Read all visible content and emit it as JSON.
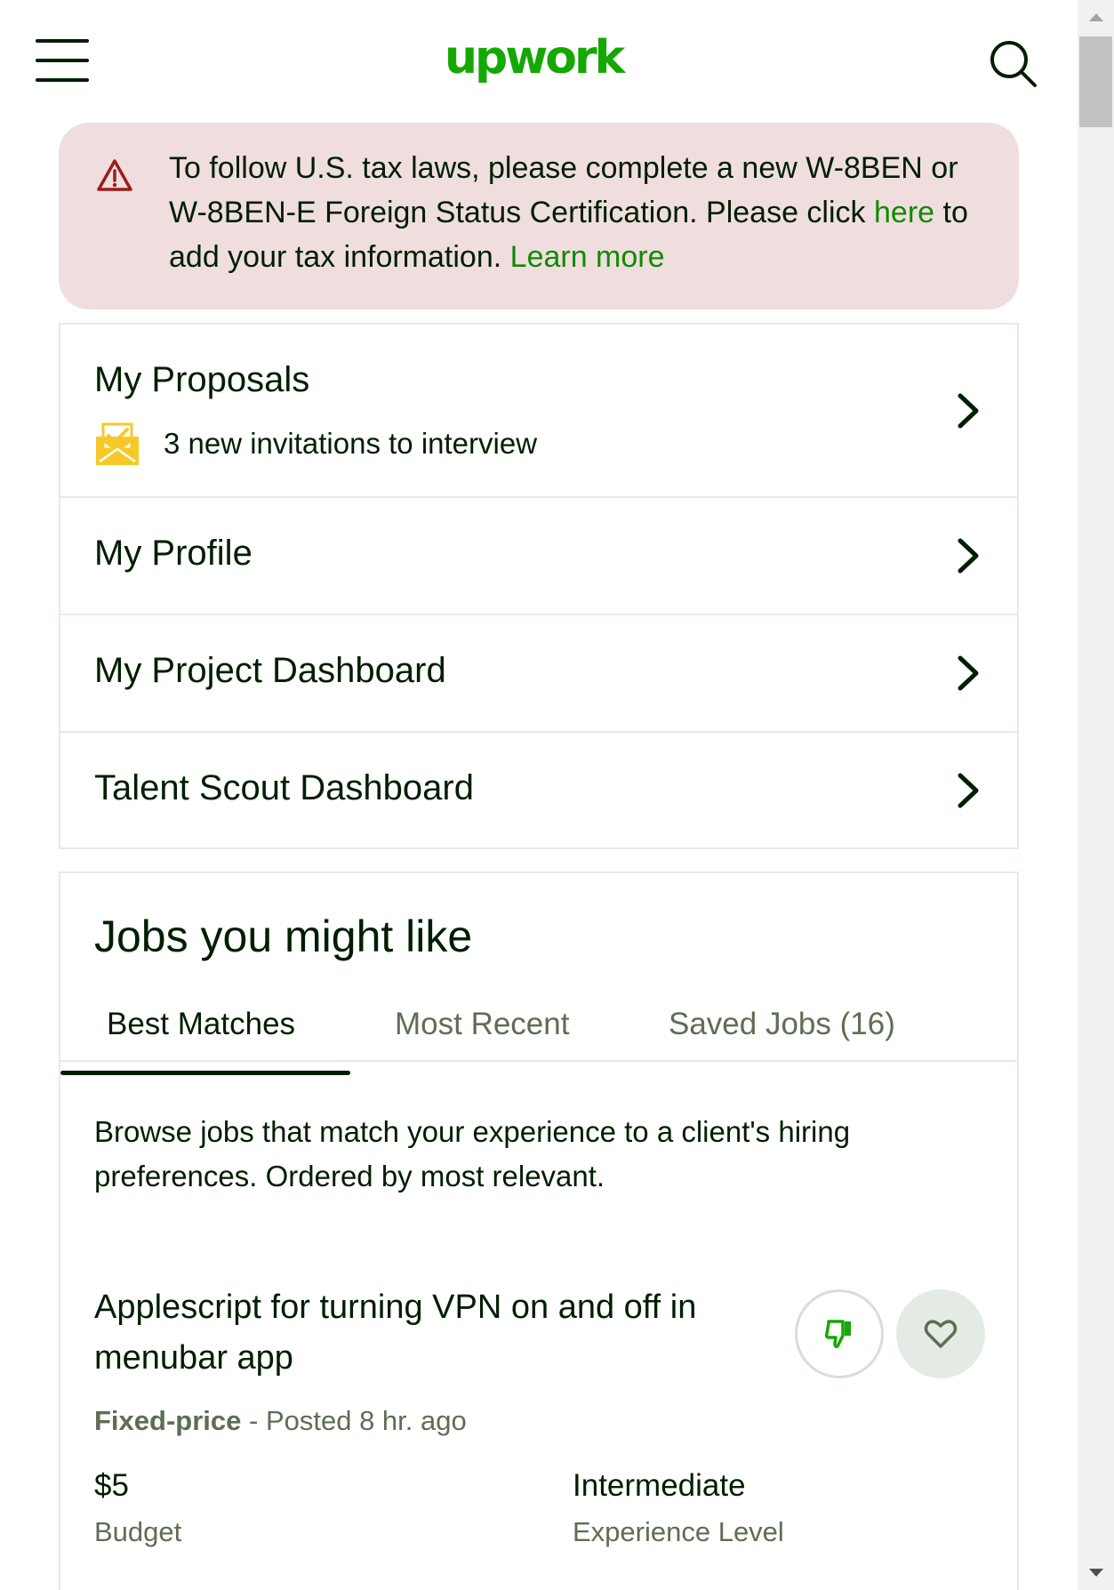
{
  "header": {
    "logo": "upwork"
  },
  "alert": {
    "text_before": "To follow U.S. tax laws, please complete a new W-8BEN or W-8BEN-E Foreign Status Certification. Please click ",
    "link_here": "here",
    "text_middle": " to add your tax information. ",
    "link_learn_more": "Learn more"
  },
  "nav": {
    "proposals": {
      "title": "My Proposals",
      "invitations": "3 new invitations to interview"
    },
    "profile": "My Profile",
    "project_dashboard": "My Project Dashboard",
    "talent_scout": "Talent Scout Dashboard"
  },
  "jobs": {
    "heading": "Jobs you might like",
    "tabs": [
      "Best Matches",
      "Most Recent",
      "Saved Jobs (16)"
    ],
    "active_tab": "Best Matches",
    "description": "Browse jobs that match your experience to a client's hiring preferences. Ordered by most relevant.",
    "job": {
      "title": "Applescript for turning VPN on and off in menubar app",
      "type": "Fixed-price",
      "posted": " - Posted 8 hr. ago",
      "budget_value": "$5",
      "budget_label": "Budget",
      "experience_value": "Intermediate",
      "experience_label": "Experience Level"
    }
  },
  "colors": {
    "brand_green": "#14a800",
    "link_green": "#108a00",
    "alert_bg": "#f0dede",
    "alert_icon": "#9e1b1b",
    "envelope": "#f6c928",
    "text_primary": "#001e00",
    "text_muted": "#5e6d55"
  },
  "icons": {
    "menu": "hamburger-menu-icon",
    "search": "search-icon",
    "alert": "warning-triangle-icon",
    "invitation": "envelope-check-icon",
    "chevron": "chevron-right-icon",
    "dislike": "thumbs-down-icon",
    "save": "heart-icon"
  }
}
